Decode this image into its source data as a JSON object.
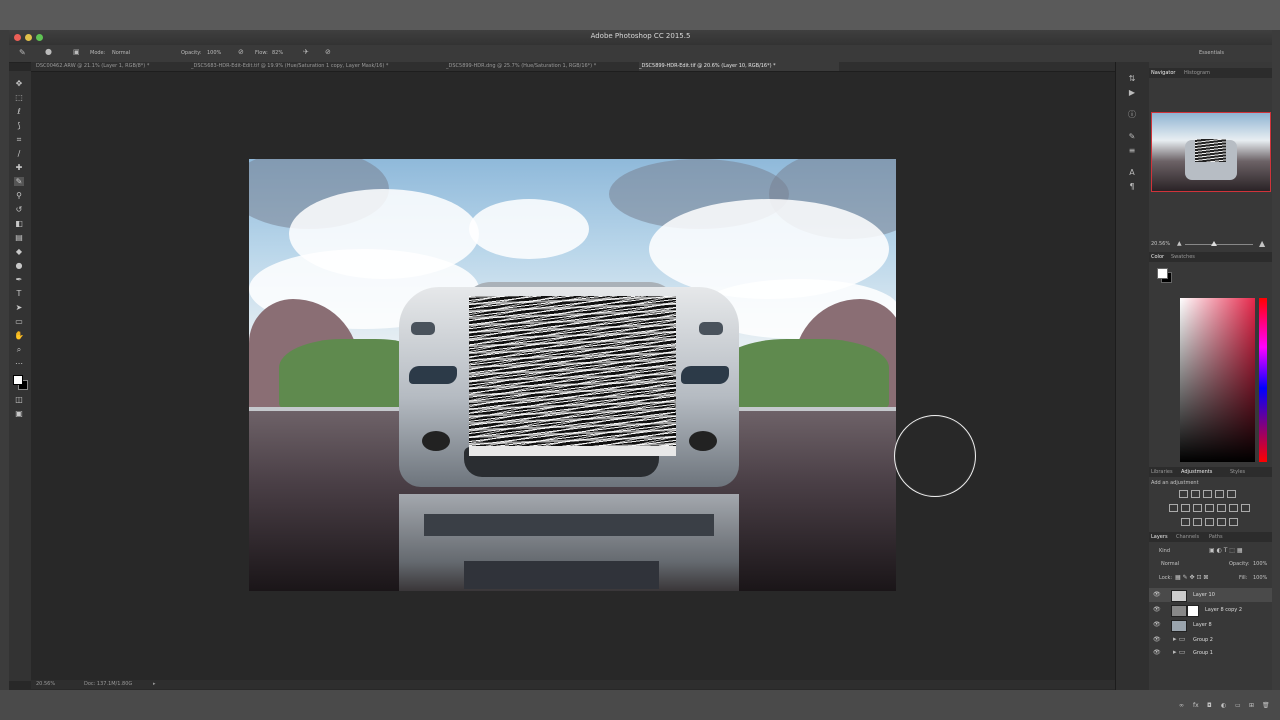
{
  "app": {
    "window_title": "Adobe Photoshop CC 2015.5",
    "workspace": "Essentials"
  },
  "options_bar": {
    "mode_label": "Mode:",
    "mode_value": "Normal",
    "opacity_label": "Opacity:",
    "opacity_value": "100%",
    "flow_label": "Flow:",
    "flow_value": "82%"
  },
  "document_tabs": [
    {
      "label": "DSC00462.ARW @ 21.1% (Layer 1, RGB/8*) *"
    },
    {
      "label": "_DSC5683-HDR-Edit-Edit.tif @ 19.9% (Hue/Saturation 1 copy, Layer Mask/16) *"
    },
    {
      "label": "_DSC5899-HDR.dng @ 25.7% (Hue/Saturation 1, RGB/16*) *"
    },
    {
      "label": "_DSC5899-HDR-Edit.tif @ 20.6% (Layer 10, RGB/16*) *"
    }
  ],
  "tools": [
    "move-tool",
    "marquee-tool",
    "lasso-tool",
    "quick-select-tool",
    "crop-tool",
    "eyedropper-tool",
    "healing-tool",
    "brush-tool",
    "clone-stamp-tool",
    "history-brush-tool",
    "eraser-tool",
    "gradient-tool",
    "blur-tool",
    "dodge-tool",
    "pen-tool",
    "type-tool",
    "path-select-tool",
    "shape-tool",
    "hand-tool",
    "zoom-tool",
    "edit-toolbar",
    "fg-bg-colors",
    "quick-mask",
    "screen-mode"
  ],
  "status_bar": {
    "zoom": "20.56%",
    "doc_info": "Doc: 137.1M/1.80G"
  },
  "navigator": {
    "tabs": [
      "Navigator",
      "Histogram"
    ],
    "zoom": "20.56%"
  },
  "color_panel": {
    "tabs": [
      "Color",
      "Swatches"
    ],
    "accent_hue": "#e6284b"
  },
  "adjustments_panel": {
    "tabs": [
      "Libraries",
      "Adjustments",
      "Styles"
    ],
    "hint": "Add an adjustment"
  },
  "layers_panel": {
    "tabs": [
      "Layers",
      "Channels",
      "Paths"
    ],
    "filter_kind": "Kind",
    "blend_mode": "Normal",
    "opacity_label": "Opacity:",
    "opacity_value": "100%",
    "lock_label": "Lock:",
    "fill_label": "Fill:",
    "fill_value": "100%",
    "layers": [
      {
        "name": "Layer 10",
        "selected": true
      },
      {
        "name": "Layer 8 copy 2",
        "selected": false
      },
      {
        "name": "Layer 8",
        "selected": false
      },
      {
        "name": "Group 2",
        "selected": false
      },
      {
        "name": "Group 1",
        "selected": false
      }
    ]
  }
}
